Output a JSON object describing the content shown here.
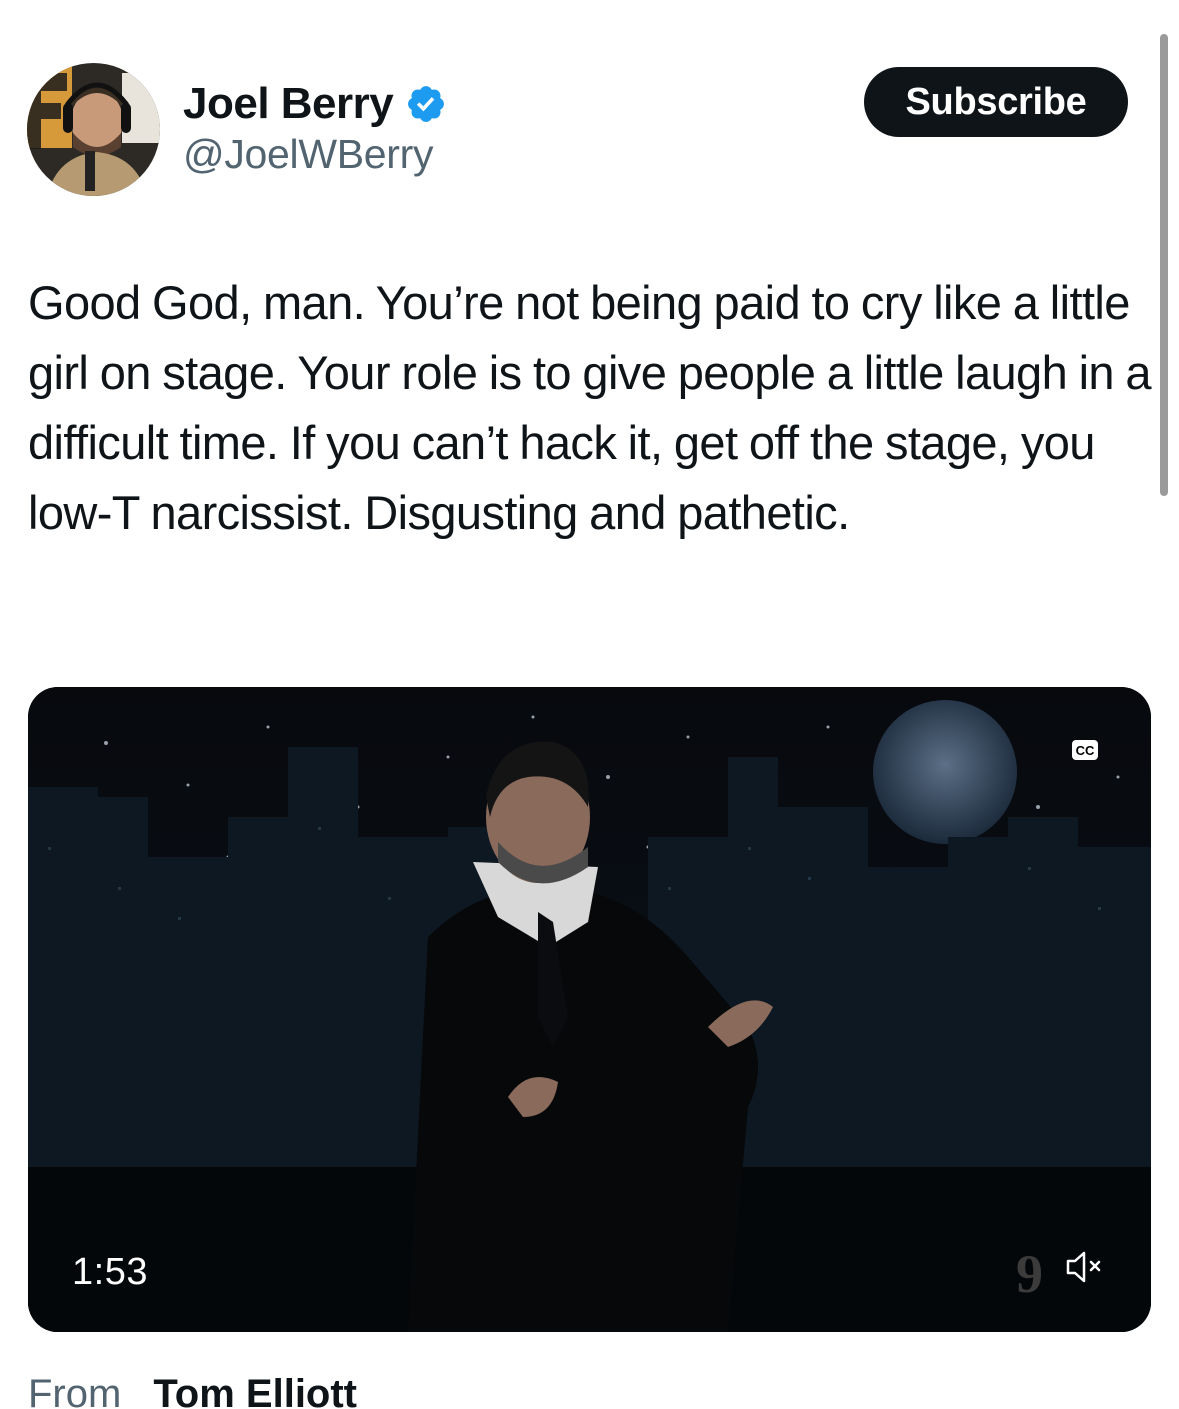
{
  "author": {
    "display_name": "Joel Berry",
    "handle": "@JoelWBerry",
    "verified": true,
    "avatar_icon": "profile-photo"
  },
  "subscribe_label": "Subscribe",
  "tweet": {
    "text": "Good God, man. You’re not being paid to cry like a little girl on stage. Your role is to give people a little laugh in a difficult time. If you can’t hack it, get off the stage, you low-T narcissist. Disgusting and pathetic."
  },
  "video": {
    "duration": "1:53",
    "cc_label": "CC",
    "network_logo": "9",
    "muted": true,
    "mute_icon": "speaker-muted-icon"
  },
  "attribution": {
    "from_label": "From",
    "from_name": "Tom Elliott"
  },
  "colors": {
    "verified_blue": "#1d9bf0",
    "text_primary": "#0f1419",
    "text_secondary": "#536471",
    "button_bg": "#0f1419"
  }
}
